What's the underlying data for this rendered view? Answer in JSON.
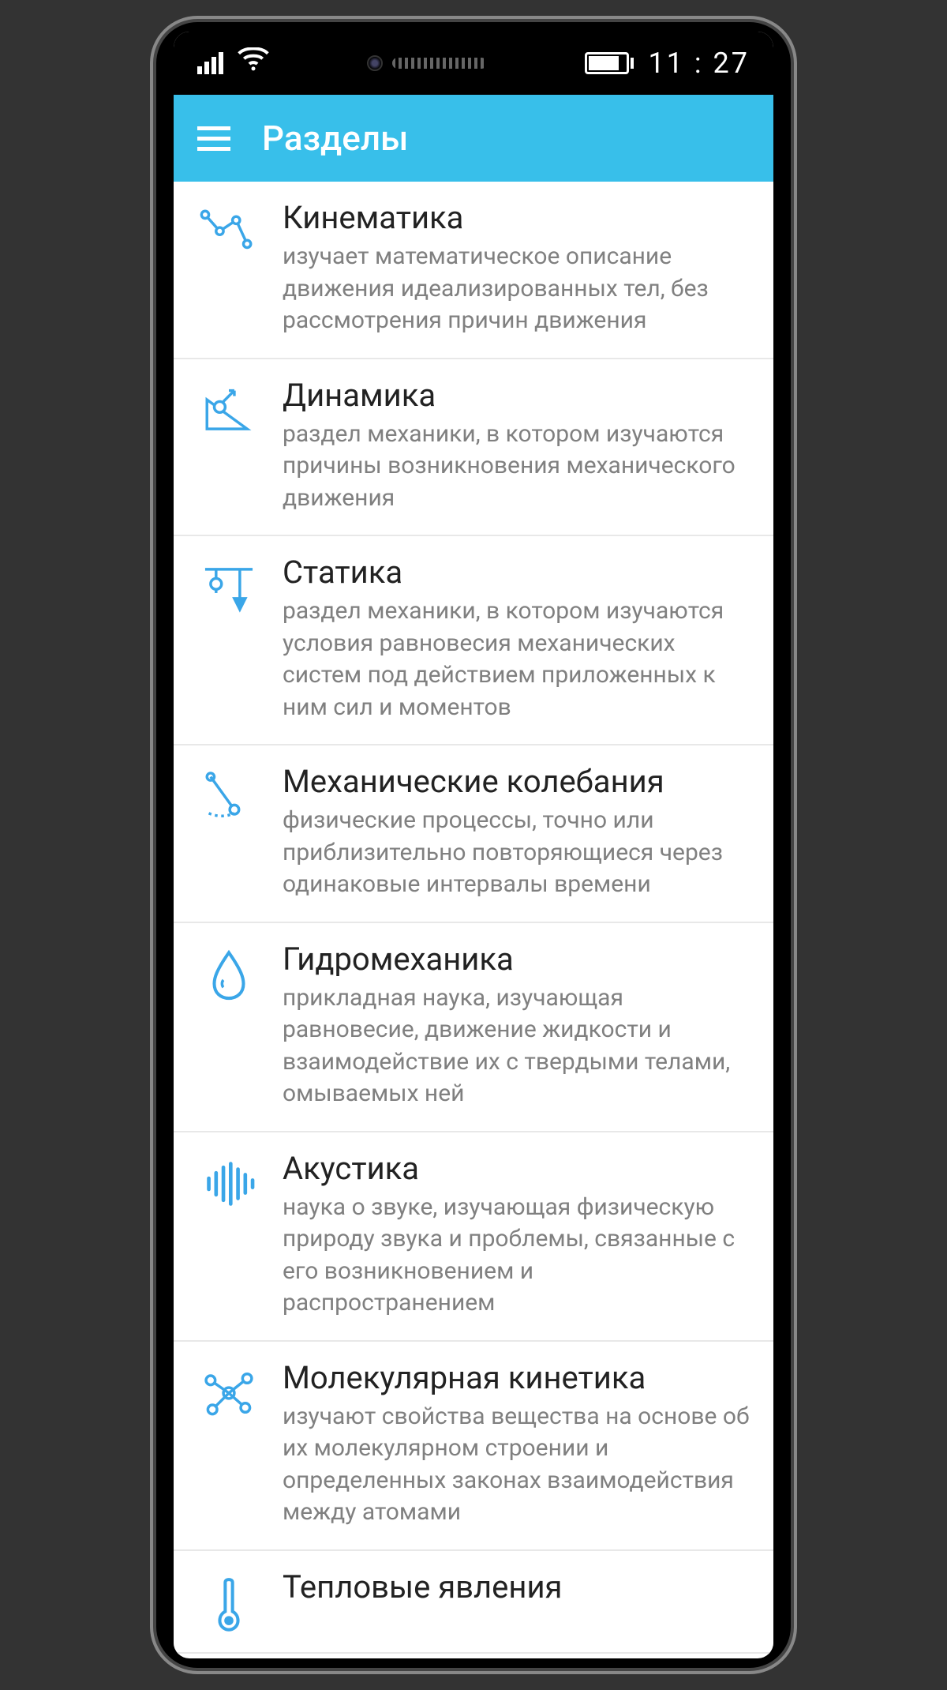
{
  "status_bar": {
    "time": "11 : 27"
  },
  "header": {
    "title": "Разделы"
  },
  "sections": [
    {
      "icon": "kinematics-icon",
      "title": "Кинематика",
      "description": "изучает математическое описание движения идеализированных тел, без рассмотрения причин движения"
    },
    {
      "icon": "dynamics-icon",
      "title": "Динамика",
      "description": "раздел механики, в котором изучаются причины возникновения механического движения"
    },
    {
      "icon": "statics-icon",
      "title": "Статика",
      "description": "раздел механики, в котором изучаются условия равновесия механических систем под действием приложенных к ним сил и моментов"
    },
    {
      "icon": "oscillation-icon",
      "title": "Механические колебания",
      "description": "физические процессы, точно или приблизительно повторяющиеся через одинаковые интервалы времени"
    },
    {
      "icon": "hydro-icon",
      "title": "Гидромеханика",
      "description": "прикладная наука, изучающая равновесие, движение жидкости и взаимодействие их с твердыми телами, омываемых  ней"
    },
    {
      "icon": "acoustics-icon",
      "title": "Акустика",
      "description": "наука о звуке, изучающая физическую природу звука и проблемы, связанные с его возникновением и распространением"
    },
    {
      "icon": "molecular-icon",
      "title": "Молекулярная кинетика",
      "description": "изучают свойства вещества на основе об их молекулярном строении и определенных законах взаимодействия между атомами"
    },
    {
      "icon": "thermal-icon",
      "title": "Тепловые явления",
      "description": ""
    }
  ],
  "colors": {
    "accent": "#38bfea",
    "icon_stroke": "#3aa6e8",
    "text_secondary": "#808080"
  }
}
